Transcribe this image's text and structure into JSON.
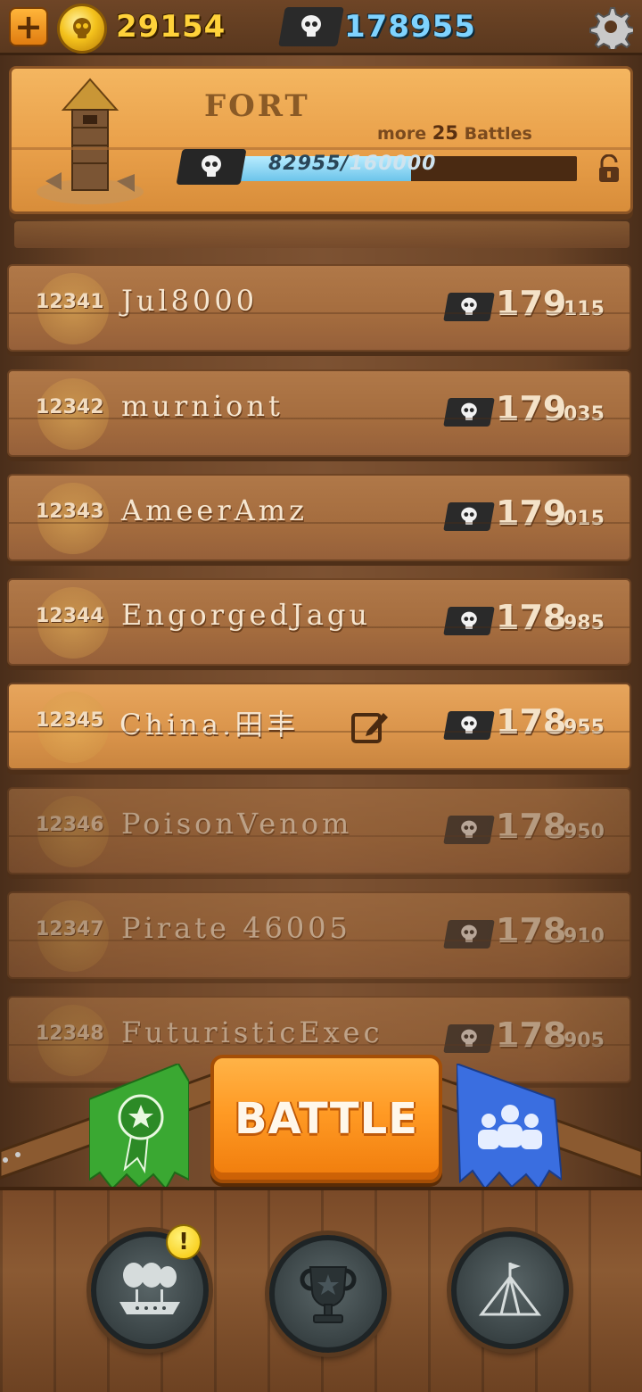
{
  "top_bar": {
    "gold": "29154",
    "skulls": "178955"
  },
  "fort": {
    "title": "FORT",
    "battles_prefix": "more",
    "battles_count": "25",
    "battles_suffix": "Battles",
    "progress_current": "82955",
    "progress_separator": "/",
    "progress_max": "160000",
    "progress_fraction": 0.518
  },
  "leaderboard": [
    {
      "rank": "12341",
      "name": "Jul8000",
      "score_big": "179",
      "score_small": "115"
    },
    {
      "rank": "12342",
      "name": "murniont",
      "score_big": "179",
      "score_small": "035"
    },
    {
      "rank": "12343",
      "name": "AmeerAmz",
      "score_big": "179",
      "score_small": "015"
    },
    {
      "rank": "12344",
      "name": "EngorgedJagu",
      "score_big": "178",
      "score_small": "985"
    },
    {
      "rank": "12345",
      "name": "China.田丰",
      "score_big": "178",
      "score_small": "955"
    },
    {
      "rank": "12346",
      "name": "PoisonVenom",
      "score_big": "178",
      "score_small": "950"
    },
    {
      "rank": "12347",
      "name": "Pirate 46005",
      "score_big": "178",
      "score_small": "910"
    },
    {
      "rank": "12348",
      "name": "FuturisticExec",
      "score_big": "178",
      "score_small": "905"
    }
  ],
  "bottom": {
    "battle_label": "BATTLE",
    "alert_symbol": "!"
  },
  "colors": {
    "gold_text": "#ffd23a",
    "skull_text": "#7fd3ff",
    "battle_orange": "#ff9a24",
    "banner_green": "#3aa832",
    "banner_blue": "#3a6ee0"
  },
  "icons": {
    "plus": "plus-icon",
    "coin": "gold-skull-coin-icon",
    "skull_flag": "skull-flag-icon",
    "settings": "gear-icon",
    "lock": "unlock-icon",
    "edit": "edit-icon",
    "ribbon": "award-ribbon-icon",
    "clan": "group-icon",
    "ship": "airship-icon",
    "trophy": "trophy-icon",
    "camp": "tent-icon"
  }
}
